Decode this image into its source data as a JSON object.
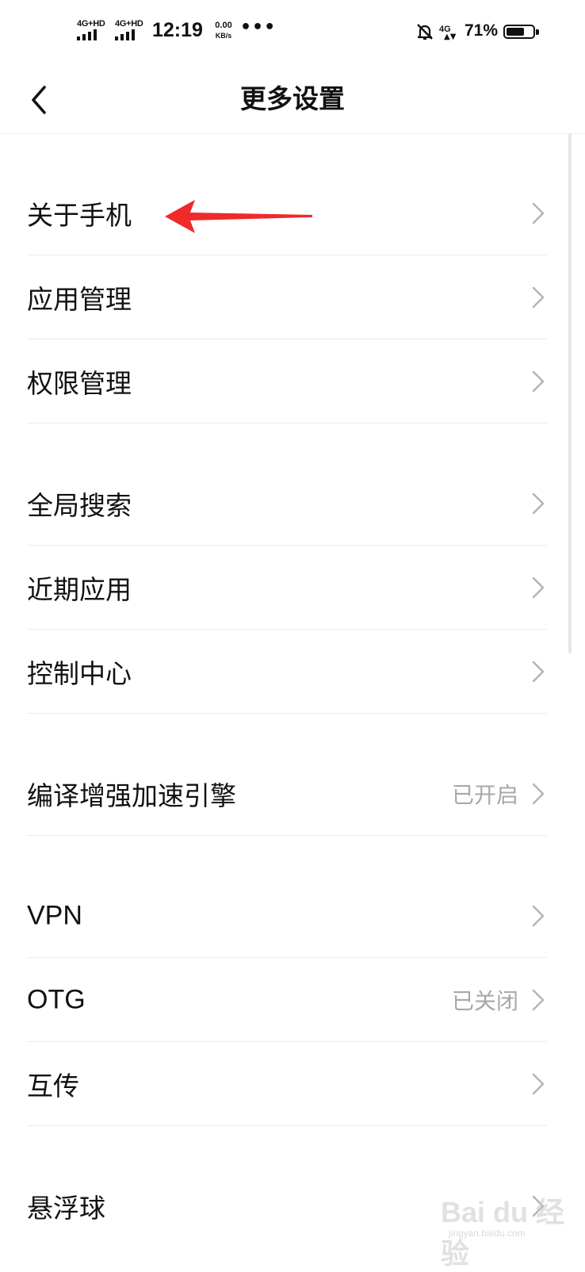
{
  "status_bar": {
    "sim1_network": "4G+HD",
    "sim2_network": "4G+HD",
    "time": "12:19",
    "speed_value": "0.00",
    "speed_unit": "KB/s",
    "more": "•••",
    "mobile_data": "4G",
    "battery_percent": "71%",
    "battery_level": 0.71,
    "icons": [
      "signal-icon",
      "signal-icon",
      "more-dots-icon",
      "mute-bell-icon",
      "mobile-data-icon",
      "battery-icon"
    ]
  },
  "header": {
    "title": "更多设置",
    "back_icon": "back-chevron-icon"
  },
  "menu": {
    "items": [
      {
        "label": "关于手机",
        "value": ""
      },
      {
        "label": "应用管理",
        "value": ""
      },
      {
        "label": "权限管理",
        "value": ""
      },
      {
        "label": "全局搜索",
        "value": ""
      },
      {
        "label": "近期应用",
        "value": ""
      },
      {
        "label": "控制中心",
        "value": ""
      },
      {
        "label": "编译增强加速引擎",
        "value": "已开启"
      },
      {
        "label": "VPN",
        "value": ""
      },
      {
        "label": "OTG",
        "value": "已关闭"
      },
      {
        "label": "互传",
        "value": ""
      },
      {
        "label": "悬浮球",
        "value": ""
      }
    ]
  },
  "annotation": {
    "arrow_color": "#ee2a2a"
  },
  "watermark": {
    "brand": "Bai du 经验",
    "site": "jingyan.baidu.com"
  },
  "colors": {
    "background": "#ffffff",
    "text": "#111111",
    "secondary_text": "#a8a8a8",
    "divider": "#ececec"
  }
}
